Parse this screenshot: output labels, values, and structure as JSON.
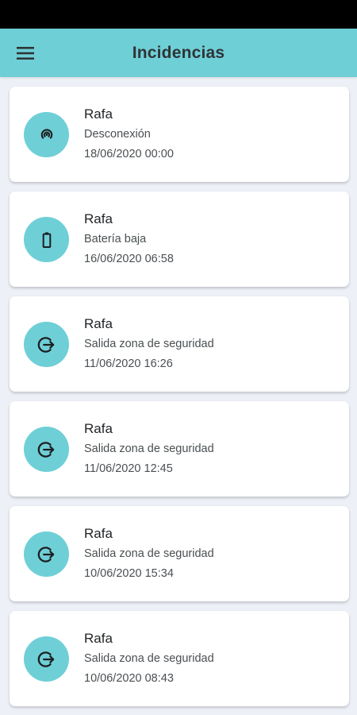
{
  "app_bar": {
    "title": "Incidencias",
    "menu_icon": "hamburger-menu-icon",
    "background": "#6fcfd7"
  },
  "incidents": [
    {
      "name": "Rafa",
      "type": "Desconexión",
      "datetime": "18/06/2020 00:00",
      "icon": "signal-disconnect-icon"
    },
    {
      "name": "Rafa",
      "type": "Batería baja",
      "datetime": "16/06/2020 06:58",
      "icon": "battery-low-icon"
    },
    {
      "name": "Rafa",
      "type": "Salida zona de seguridad",
      "datetime": "11/06/2020 16:26",
      "icon": "exit-zone-icon"
    },
    {
      "name": "Rafa",
      "type": "Salida zona de seguridad",
      "datetime": "11/06/2020 12:45",
      "icon": "exit-zone-icon"
    },
    {
      "name": "Rafa",
      "type": "Salida zona de seguridad",
      "datetime": "10/06/2020 15:34",
      "icon": "exit-zone-icon"
    },
    {
      "name": "Rafa",
      "type": "Salida zona de seguridad",
      "datetime": "10/06/2020 08:43",
      "icon": "exit-zone-icon"
    }
  ]
}
